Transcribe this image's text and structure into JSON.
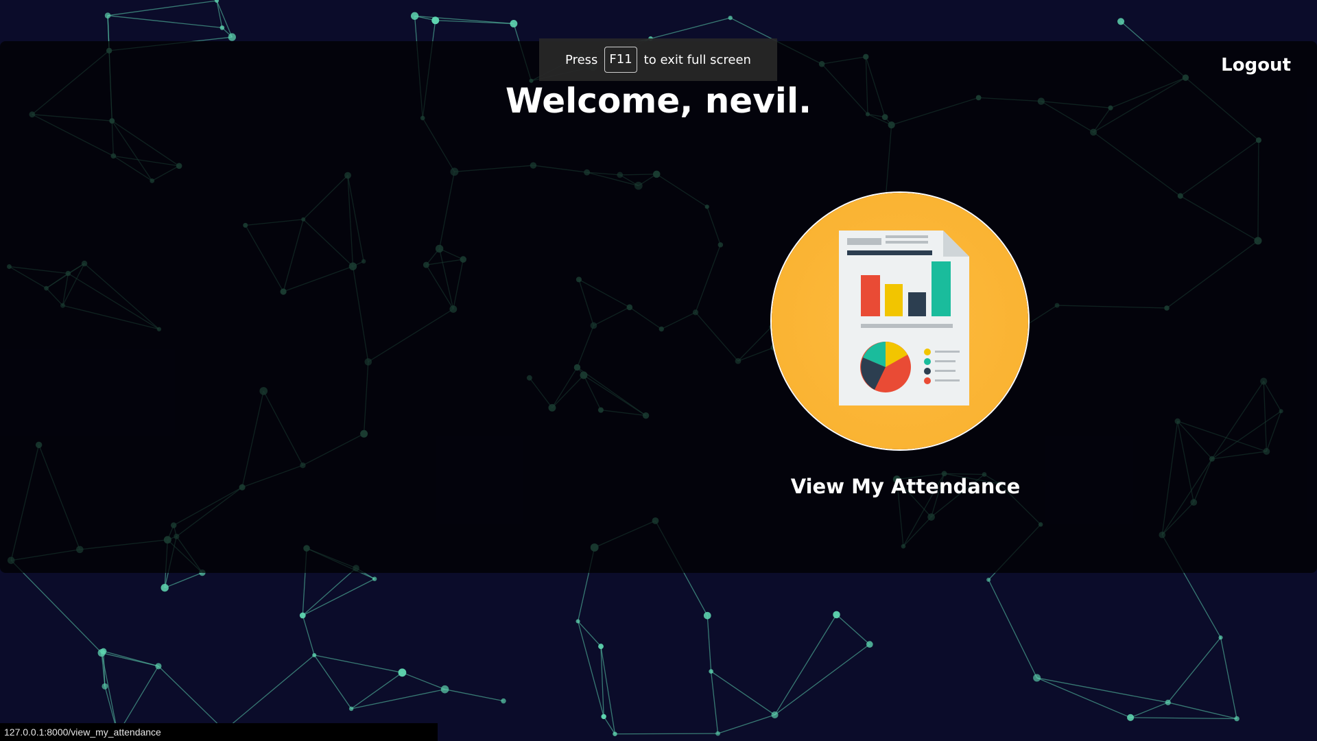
{
  "fullscreen_hint": {
    "press": "Press",
    "key": "F11",
    "suffix": "to exit full screen"
  },
  "header": {
    "logout_label": "Logout",
    "welcome": "Welcome, nevil."
  },
  "dashboard": {
    "cards": [
      {
        "label": "View My Attendance",
        "icon": "report-document-icon"
      }
    ]
  },
  "status_bar": {
    "url": "127.0.0.1:8000/view_my_attendance"
  },
  "colors": {
    "background": "#0b0c2a",
    "network_lines": "#5fd6b0",
    "card_circle": "#fdbb3e"
  }
}
